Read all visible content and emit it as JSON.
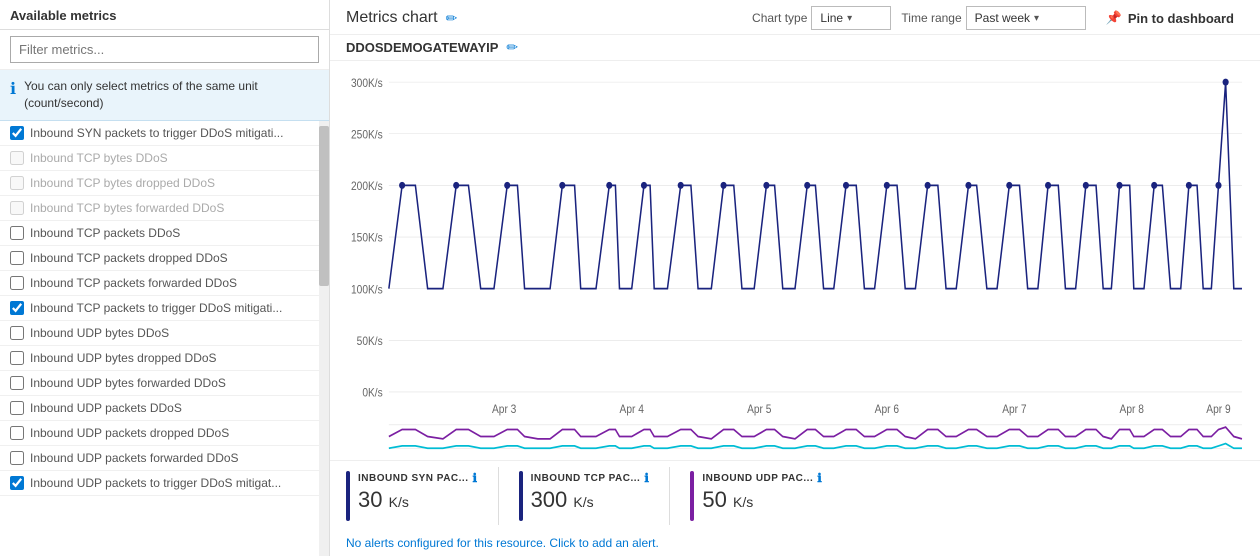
{
  "leftPanel": {
    "header": "Available metrics",
    "filterPlaceholder": "Filter metrics...",
    "infoBanner": "You can only select metrics of the same unit (count/second)",
    "metrics": [
      {
        "id": 1,
        "label": "Inbound SYN packets to trigger DDoS mitigati...",
        "checked": true,
        "disabled": false
      },
      {
        "id": 2,
        "label": "Inbound TCP bytes DDoS",
        "checked": false,
        "disabled": true
      },
      {
        "id": 3,
        "label": "Inbound TCP bytes dropped DDoS",
        "checked": false,
        "disabled": true
      },
      {
        "id": 4,
        "label": "Inbound TCP bytes forwarded DDoS",
        "checked": false,
        "disabled": true
      },
      {
        "id": 5,
        "label": "Inbound TCP packets DDoS",
        "checked": false,
        "disabled": false
      },
      {
        "id": 6,
        "label": "Inbound TCP packets dropped DDoS",
        "checked": false,
        "disabled": false
      },
      {
        "id": 7,
        "label": "Inbound TCP packets forwarded DDoS",
        "checked": false,
        "disabled": false
      },
      {
        "id": 8,
        "label": "Inbound TCP packets to trigger DDoS mitigati...",
        "checked": true,
        "disabled": false
      },
      {
        "id": 9,
        "label": "Inbound UDP bytes DDoS",
        "checked": false,
        "disabled": false
      },
      {
        "id": 10,
        "label": "Inbound UDP bytes dropped DDoS",
        "checked": false,
        "disabled": false
      },
      {
        "id": 11,
        "label": "Inbound UDP bytes forwarded DDoS",
        "checked": false,
        "disabled": false
      },
      {
        "id": 12,
        "label": "Inbound UDP packets DDoS",
        "checked": false,
        "disabled": false
      },
      {
        "id": 13,
        "label": "Inbound UDP packets dropped DDoS",
        "checked": false,
        "disabled": false
      },
      {
        "id": 14,
        "label": "Inbound UDP packets forwarded DDoS",
        "checked": false,
        "disabled": false
      },
      {
        "id": 15,
        "label": "Inbound UDP packets to trigger DDoS mitigat...",
        "checked": true,
        "disabled": false
      }
    ]
  },
  "rightPanel": {
    "chartTitle": "Metrics chart",
    "resourceName": "DDOSDEMOGATEWAYIP",
    "chartType": {
      "label": "Chart type",
      "value": "Line"
    },
    "timeRange": {
      "label": "Time range",
      "value": "Past week"
    },
    "pinBtn": "Pin to dashboard",
    "xLabels": [
      "Apr 3",
      "Apr 4",
      "Apr 5",
      "Apr 6",
      "Apr 7",
      "Apr 8",
      "Apr 9"
    ],
    "yLabels": [
      "0K/s",
      "50K/s",
      "100K/s",
      "150K/s",
      "200K/s",
      "250K/s",
      "300K/s"
    ],
    "legend": [
      {
        "id": "syn",
        "label": "INBOUND SYN PAC...",
        "value": "30",
        "unit": "K/s",
        "color": "#1a237e"
      },
      {
        "id": "tcp",
        "label": "INBOUND TCP PAC...",
        "value": "300",
        "unit": "K/s",
        "color": "#1a237e"
      },
      {
        "id": "udp",
        "label": "INBOUND UDP PAC...",
        "value": "50",
        "unit": "K/s",
        "color": "#7b1fa2"
      }
    ],
    "alertText": "No alerts configured for this resource. Click to add an alert.",
    "editIconLabel": "✏",
    "pinIconLabel": "📌"
  }
}
